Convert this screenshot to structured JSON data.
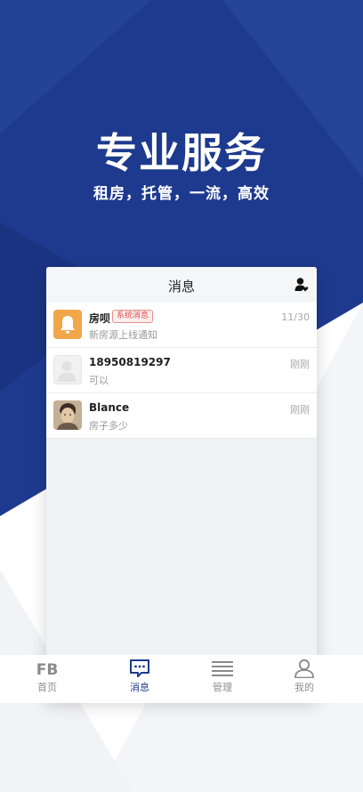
{
  "hero": {
    "title": "专业服务",
    "subtitle": "租房，托管，一流，高效"
  },
  "messages_screen": {
    "title": "消息",
    "action_icon": "contact-heart-icon",
    "conversations": [
      {
        "name": "房呗",
        "badge": "系统消息",
        "preview": "新房源上线通知",
        "time": "11/30",
        "avatar": "bell-icon"
      },
      {
        "name": "18950819297",
        "preview": "可以",
        "time": "刚刚",
        "avatar": "default-user-avatar"
      },
      {
        "name": "Blance",
        "preview": "房子多少",
        "time": "刚刚",
        "avatar": "user-photo-avatar"
      }
    ]
  },
  "tabbar": {
    "items": [
      {
        "label": "首页",
        "icon": "fb-logo-icon",
        "active": false
      },
      {
        "label": "消息",
        "icon": "message-bubble-icon",
        "active": true
      },
      {
        "label": "管理",
        "icon": "list-icon",
        "active": false
      },
      {
        "label": "我的",
        "icon": "person-icon",
        "active": false
      }
    ]
  },
  "colors": {
    "brand_navy": "#1e3a8a",
    "badge_red": "#d9534f",
    "bell_orange": "#f2a64a"
  }
}
